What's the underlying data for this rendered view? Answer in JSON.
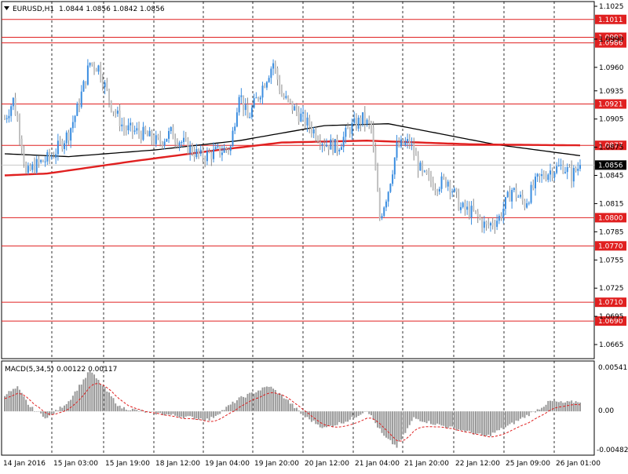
{
  "header": {
    "symbol_timeframe": "EURUSD,H1",
    "ohlc": "1.0844 1.0856 1.0842 1.0856"
  },
  "macd": {
    "label": "MACD(5,34,5)",
    "values": "0.00122 0.00117",
    "scale": [
      "0.00541",
      "0.00",
      "-0.00482"
    ]
  },
  "colors": {
    "bull": "#3a8de0",
    "bear": "#c0c0c0",
    "level": "#e02020",
    "ma_red": "#e02020",
    "ma_black": "#000000",
    "macd_hist": "#999999",
    "macd_signal": "#e02020"
  },
  "chart_data": {
    "type": "candlestick",
    "ylim": [
      1.065,
      1.103
    ],
    "price_ticks": [
      "1.1025",
      "1.0990",
      "1.0960",
      "1.0935",
      "1.0905",
      "1.0875",
      "1.0845",
      "1.0815",
      "1.0785",
      "1.0755",
      "1.0725",
      "1.0695",
      "1.0665"
    ],
    "x_ticks": [
      "14 Jan 2016",
      "15 Jan 03:00",
      "15 Jan 19:00",
      "18 Jan 12:00",
      "19 Jan 04:00",
      "19 Jan 20:00",
      "20 Jan 12:00",
      "21 Jan 04:00",
      "21 Jan 20:00",
      "22 Jan 12:00",
      "25 Jan 09:00",
      "26 Jan 01:00"
    ],
    "levels": [
      {
        "label": "1.1011",
        "value": 1.1011
      },
      {
        "label": "1.0992",
        "value": 1.0992
      },
      {
        "label": "1.0986",
        "value": 1.0986
      },
      {
        "label": "1.0921",
        "value": 1.0921
      },
      {
        "label": "1.0877",
        "value": 1.0877
      },
      {
        "label": "1.0800",
        "value": 1.08
      },
      {
        "label": "1.0770",
        "value": 1.077
      },
      {
        "label": "1.0710",
        "value": 1.071
      },
      {
        "label": "1.0690",
        "value": 1.069
      }
    ],
    "current": {
      "label": "1.0856",
      "value": 1.0856
    },
    "close_anchors": [
      [
        0,
        1.0905
      ],
      [
        4,
        1.0925
      ],
      [
        8,
        1.088
      ],
      [
        10,
        1.0845
      ],
      [
        14,
        1.0855
      ],
      [
        22,
        1.0865
      ],
      [
        30,
        1.089
      ],
      [
        34,
        1.0915
      ],
      [
        40,
        1.0965
      ],
      [
        44,
        1.096
      ],
      [
        50,
        1.092
      ],
      [
        56,
        1.0895
      ],
      [
        64,
        1.089
      ],
      [
        72,
        1.088
      ],
      [
        78,
        1.089
      ],
      [
        86,
        1.0875
      ],
      [
        92,
        1.0865
      ],
      [
        100,
        1.087
      ],
      [
        106,
        1.0875
      ],
      [
        110,
        1.0935
      ],
      [
        114,
        1.0905
      ],
      [
        120,
        1.0935
      ],
      [
        126,
        1.0965
      ],
      [
        130,
        1.093
      ],
      [
        136,
        1.0915
      ],
      [
        142,
        1.09
      ],
      [
        150,
        1.088
      ],
      [
        156,
        1.0875
      ],
      [
        162,
        1.0895
      ],
      [
        168,
        1.0905
      ],
      [
        172,
        1.0895
      ],
      [
        176,
        1.08
      ],
      [
        180,
        1.083
      ],
      [
        184,
        1.0875
      ],
      [
        190,
        1.088
      ],
      [
        196,
        1.0845
      ],
      [
        202,
        1.0835
      ],
      [
        208,
        1.084
      ],
      [
        214,
        1.081
      ],
      [
        220,
        1.0805
      ],
      [
        226,
        1.079
      ],
      [
        232,
        1.08
      ],
      [
        238,
        1.083
      ],
      [
        244,
        1.0815
      ],
      [
        250,
        1.084
      ],
      [
        256,
        1.085
      ],
      [
        262,
        1.0855
      ],
      [
        266,
        1.0845
      ],
      [
        270,
        1.0856
      ]
    ],
    "ma_red_anchors": [
      [
        0,
        1.0845
      ],
      [
        20,
        1.0847
      ],
      [
        60,
        1.086
      ],
      [
        100,
        1.0872
      ],
      [
        130,
        1.088
      ],
      [
        170,
        1.0882
      ],
      [
        220,
        1.0878
      ],
      [
        270,
        1.0877
      ]
    ],
    "ma_black_anchors": [
      [
        0,
        1.0868
      ],
      [
        30,
        1.0865
      ],
      [
        70,
        1.0872
      ],
      [
        110,
        1.0882
      ],
      [
        150,
        1.0898
      ],
      [
        180,
        1.09
      ],
      [
        230,
        1.0878
      ],
      [
        270,
        1.0866
      ]
    ],
    "macd_hist_anchors": [
      [
        0,
        0.002
      ],
      [
        6,
        0.0028
      ],
      [
        12,
        0.0005
      ],
      [
        20,
        -0.0008
      ],
      [
        30,
        0.0012
      ],
      [
        40,
        0.0048
      ],
      [
        46,
        0.003
      ],
      [
        54,
        0.0005
      ],
      [
        64,
        0.0
      ],
      [
        80,
        -0.0005
      ],
      [
        96,
        -0.001
      ],
      [
        110,
        0.0015
      ],
      [
        124,
        0.003
      ],
      [
        132,
        0.0015
      ],
      [
        140,
        -0.0005
      ],
      [
        150,
        -0.002
      ],
      [
        162,
        -0.001
      ],
      [
        170,
        0.0002
      ],
      [
        178,
        -0.003
      ],
      [
        184,
        -0.0042
      ],
      [
        192,
        -0.0008
      ],
      [
        202,
        -0.0015
      ],
      [
        214,
        -0.0022
      ],
      [
        226,
        -0.003
      ],
      [
        238,
        -0.0015
      ],
      [
        250,
        0.0002
      ],
      [
        256,
        0.0012
      ],
      [
        262,
        0.001
      ],
      [
        270,
        0.0012
      ]
    ]
  }
}
